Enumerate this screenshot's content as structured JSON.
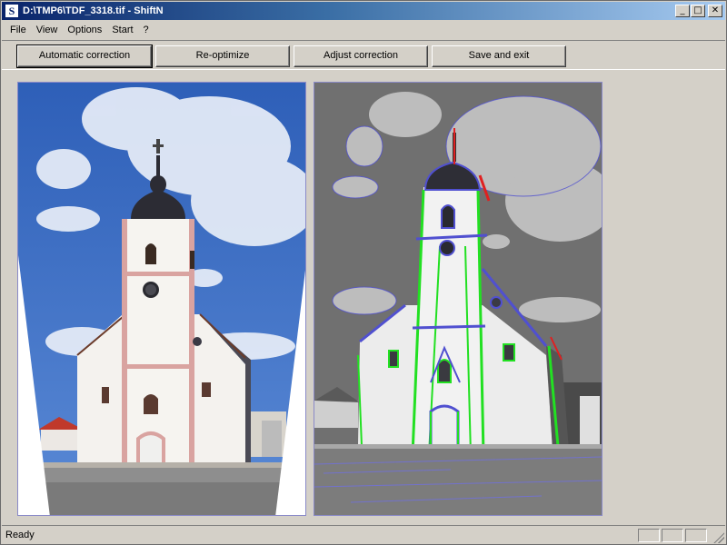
{
  "window": {
    "title": "D:\\TMP6\\TDF_3318.tif - ShiftN",
    "icon_letter": "S",
    "controls": {
      "minimize": "_",
      "maximize": "□",
      "close": "✕"
    }
  },
  "menu": {
    "items": [
      {
        "label": "File"
      },
      {
        "label": "View"
      },
      {
        "label": "Options"
      },
      {
        "label": "Start"
      },
      {
        "label": "?"
      }
    ]
  },
  "toolbar": {
    "automatic_correction": "Automatic correction",
    "re_optimize": "Re-optimize",
    "adjust_correction": "Adjust correction",
    "save_and_exit": "Save and exit"
  },
  "images": {
    "left": {
      "description_icon": "corrected-image"
    },
    "right": {
      "description_icon": "original-image-with-detected-lines"
    }
  },
  "statusbar": {
    "text": "Ready"
  },
  "colors": {
    "titlebar_start": "#0a246a",
    "titlebar_end": "#a6caf0",
    "sky": "#3b6fc4",
    "detected_line_green": "#22e022",
    "detected_line_blue": "#5050d0",
    "detected_line_red": "#e02020"
  }
}
